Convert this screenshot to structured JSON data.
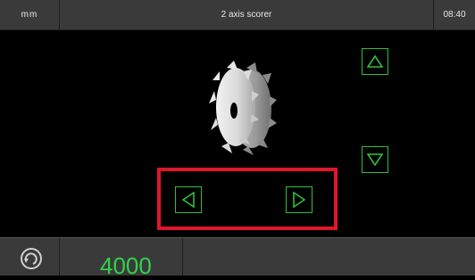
{
  "header": {
    "unit": "mm",
    "title": "2 axis scorer",
    "time": "08:40"
  },
  "controls": {
    "up_icon": "triangle-up-icon",
    "down_icon": "triangle-down-icon",
    "left_icon": "triangle-left-icon",
    "right_icon": "triangle-right-icon",
    "accent_color": "#2fbf3a",
    "highlight_color": "#e0162a"
  },
  "footer": {
    "icon": "rotation-speed-icon",
    "value": "4000",
    "value_color": "#32d24a"
  }
}
